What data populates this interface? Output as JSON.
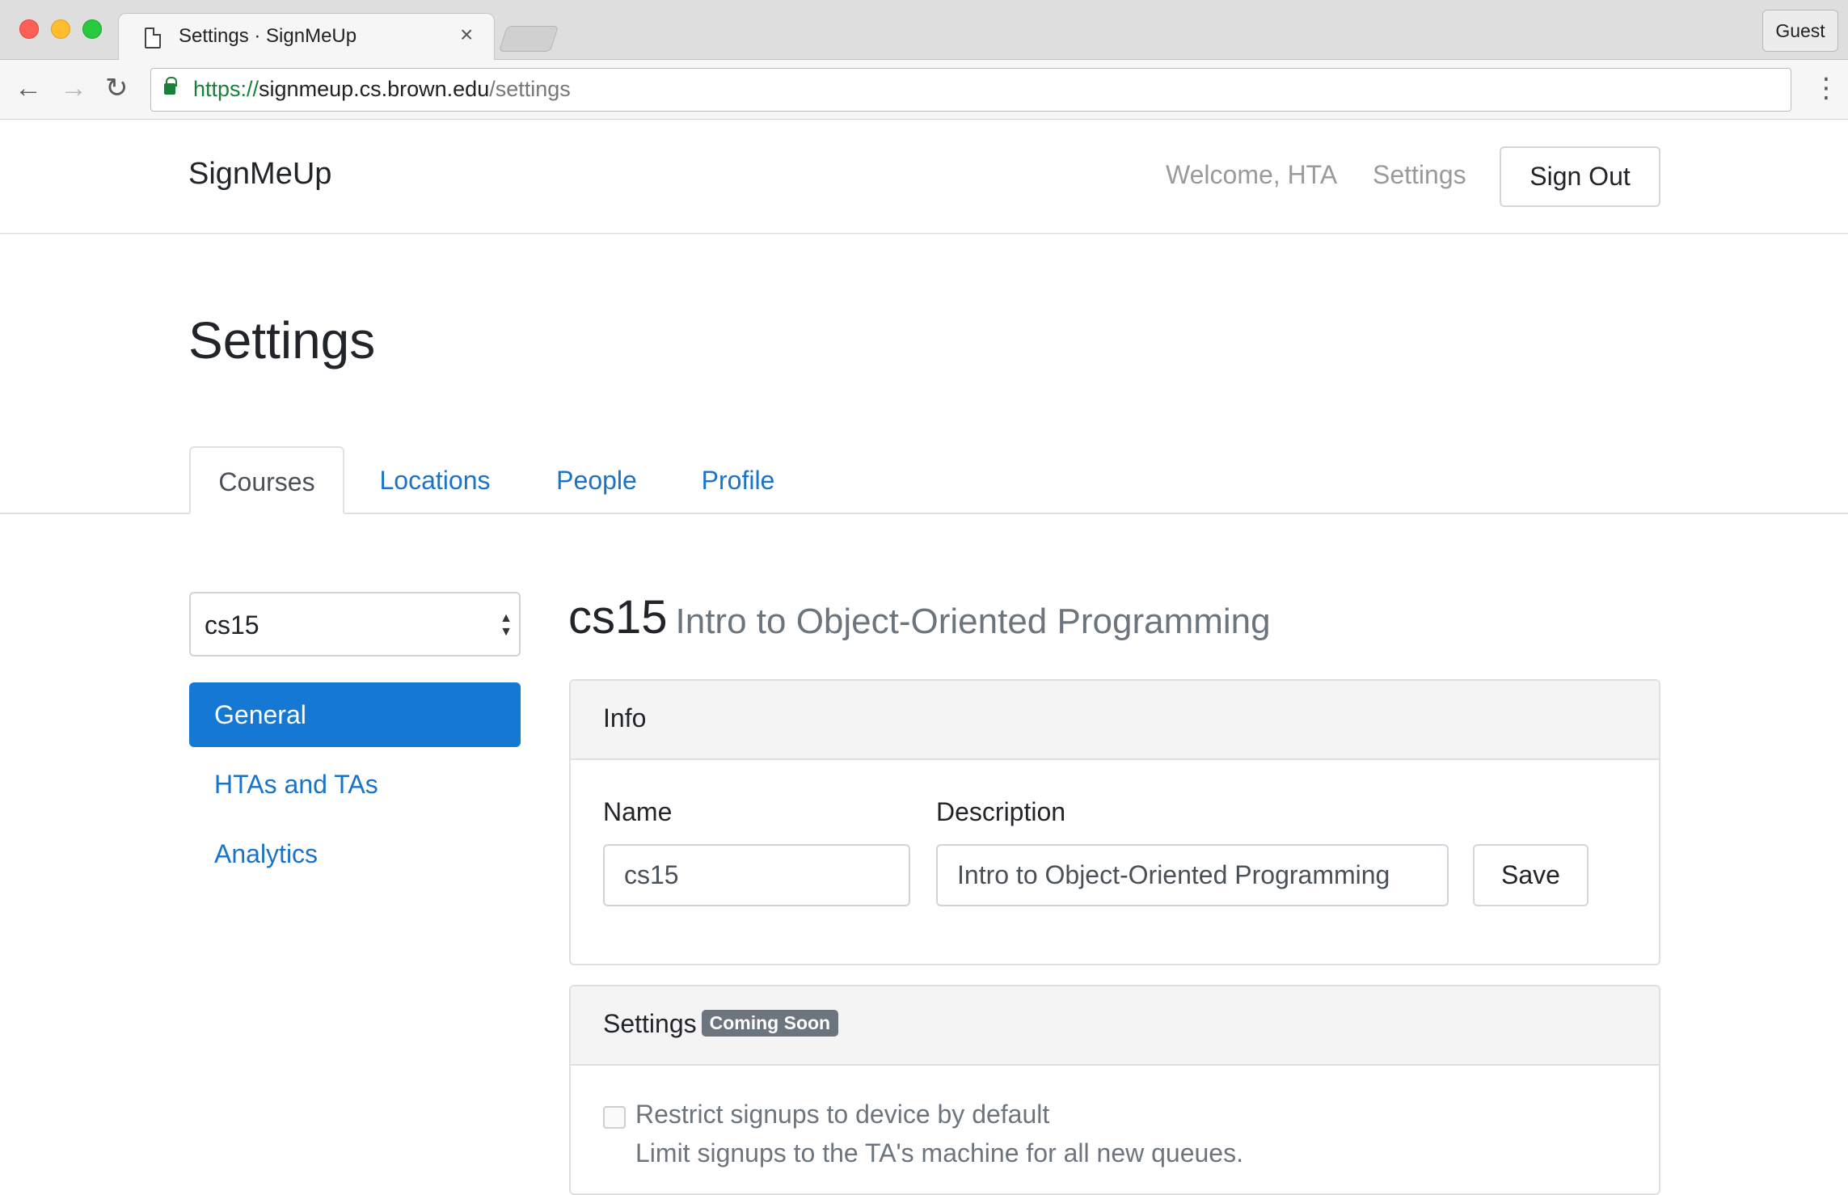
{
  "browser": {
    "tab_title": "Settings · SignMeUp",
    "tab_close": "×",
    "guest_label": "Guest",
    "url_scheme": "https://",
    "url_host": "signmeup.cs.brown.edu",
    "url_path": "/settings",
    "back_glyph": "←",
    "forward_glyph": "→",
    "reload_glyph": "↻",
    "menu_glyph": "⋮"
  },
  "navbar": {
    "brand": "SignMeUp",
    "welcome": "Welcome, HTA",
    "settings_link": "Settings",
    "sign_out": "Sign Out"
  },
  "page": {
    "title": "Settings",
    "tabs": [
      {
        "label": "Courses",
        "active": true
      },
      {
        "label": "Locations",
        "active": false
      },
      {
        "label": "People",
        "active": false
      },
      {
        "label": "Profile",
        "active": false
      }
    ]
  },
  "sidebar": {
    "course_select": {
      "value": "cs15",
      "arrows": "▲▼"
    },
    "items": [
      {
        "label": "General",
        "active": true
      },
      {
        "label": "HTAs and TAs",
        "active": false
      },
      {
        "label": "Analytics",
        "active": false
      }
    ]
  },
  "course": {
    "code": "cs15",
    "description": "Intro to Object-Oriented Programming"
  },
  "info_card": {
    "header": "Info",
    "name_label": "Name",
    "name_value": "cs15",
    "description_label": "Description",
    "description_value": "Intro to Object-Oriented Programming",
    "save_label": "Save"
  },
  "settings_card": {
    "header": "Settings",
    "badge": "Coming Soon",
    "checkbox_label": "Restrict signups to device by default",
    "checkbox_help": "Limit signups to the TA's machine for all new queues."
  },
  "colors": {
    "primary": "#1478d4",
    "link": "#1a73c9",
    "muted": "#6c757d",
    "secure_green": "#188038"
  }
}
